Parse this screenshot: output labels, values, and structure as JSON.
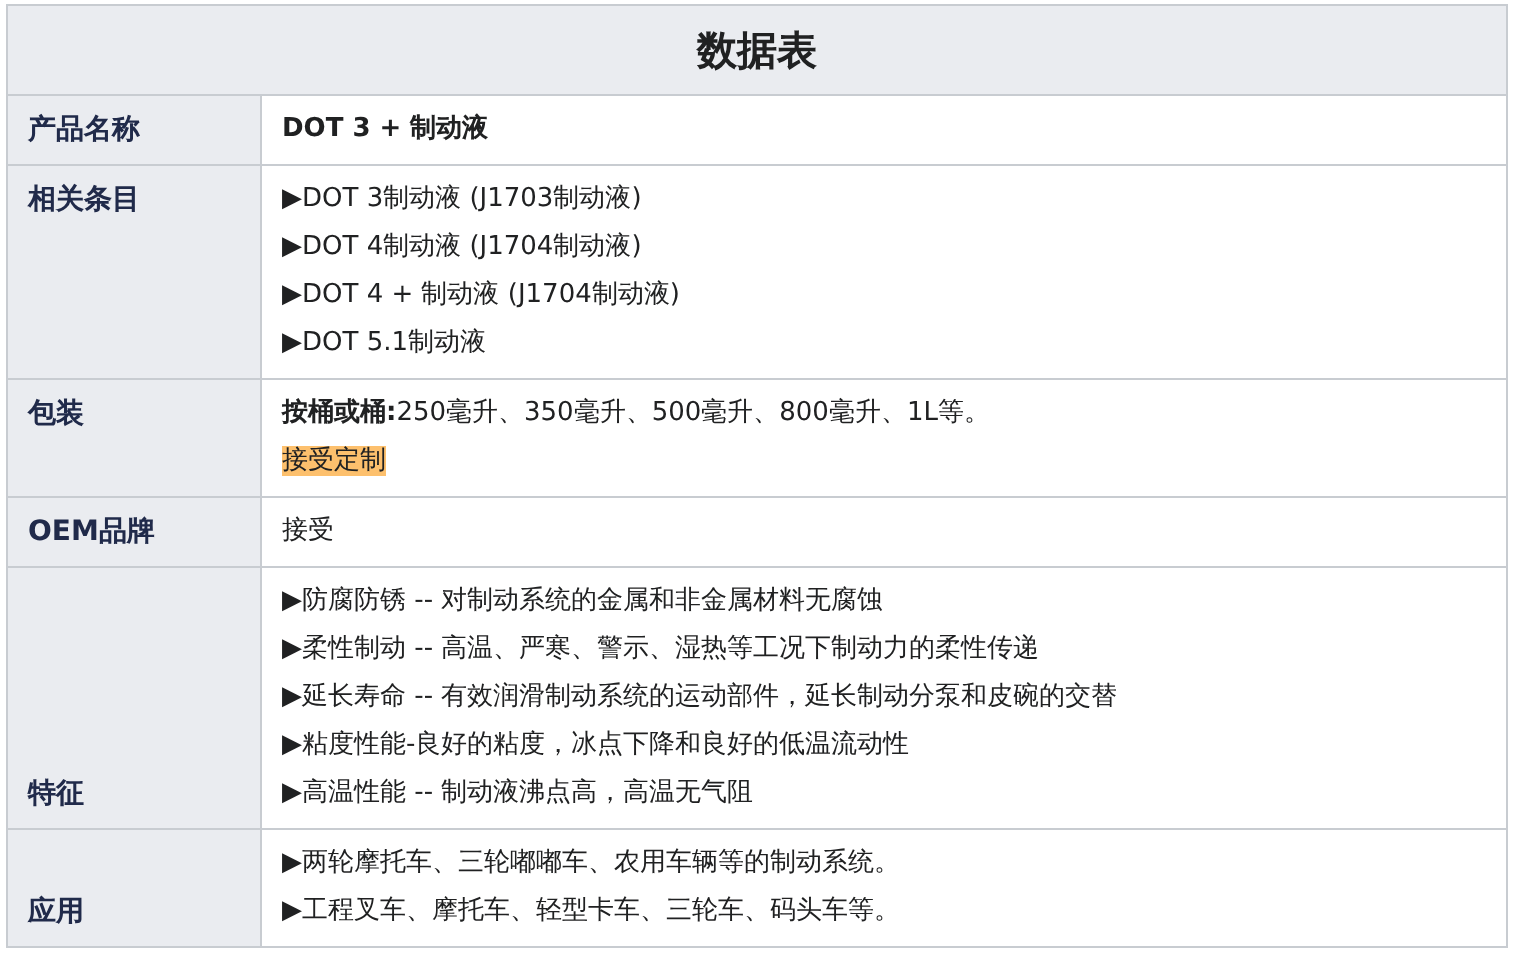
{
  "title": "数据表",
  "rows": [
    {
      "label": "产品名称",
      "lines": [
        {
          "kind": "bold",
          "text": "DOT 3 + 制动液"
        }
      ]
    },
    {
      "label": "相关条目",
      "lines": [
        {
          "kind": "plain",
          "text": "▶DOT 3制动液 (J1703制动液)"
        },
        {
          "kind": "plain",
          "text": "▶DOT 4制动液 (J1704制动液)"
        },
        {
          "kind": "plain",
          "text": "▶DOT 4 + 制动液 (J1704制动液)"
        },
        {
          "kind": "plain",
          "text": "▶DOT 5.1制动液"
        }
      ]
    },
    {
      "label": "包装",
      "lines": [
        {
          "kind": "plain",
          "text": "**按桶或桶:**250毫升、350毫升、500毫升、800毫升、1L等。"
        },
        {
          "kind": "highlight",
          "text": "接受定制"
        }
      ]
    },
    {
      "label": "OEM品牌",
      "lines": [
        {
          "kind": "plain",
          "text": "接受"
        }
      ]
    },
    {
      "label": "特征",
      "lines": [
        {
          "kind": "plain",
          "text": "▶防腐防锈 -- 对制动系统的金属和非金属材料无腐蚀"
        },
        {
          "kind": "plain",
          "text": "▶柔性制动 -- 高温、严寒、警示、湿热等工况下制动力的柔性传递"
        },
        {
          "kind": "plain",
          "text": "▶延长寿命 -- 有效润滑制动系统的运动部件，延长制动分泵和皮碗的交替"
        },
        {
          "kind": "plain",
          "text": "▶粘度性能-良好的粘度，冰点下降和良好的低温流动性"
        },
        {
          "kind": "plain",
          "text": "▶高温性能 -- 制动液沸点高，高温无气阻"
        }
      ]
    },
    {
      "label": "应用",
      "lines": [
        {
          "kind": "plain",
          "text": "▶两轮摩托车、三轮嘟嘟车、农用车辆等的制动系统。"
        },
        {
          "kind": "plain",
          "text": "▶工程叉车、摩托车、轻型卡车、三轮车、码头车等。"
        }
      ]
    }
  ]
}
